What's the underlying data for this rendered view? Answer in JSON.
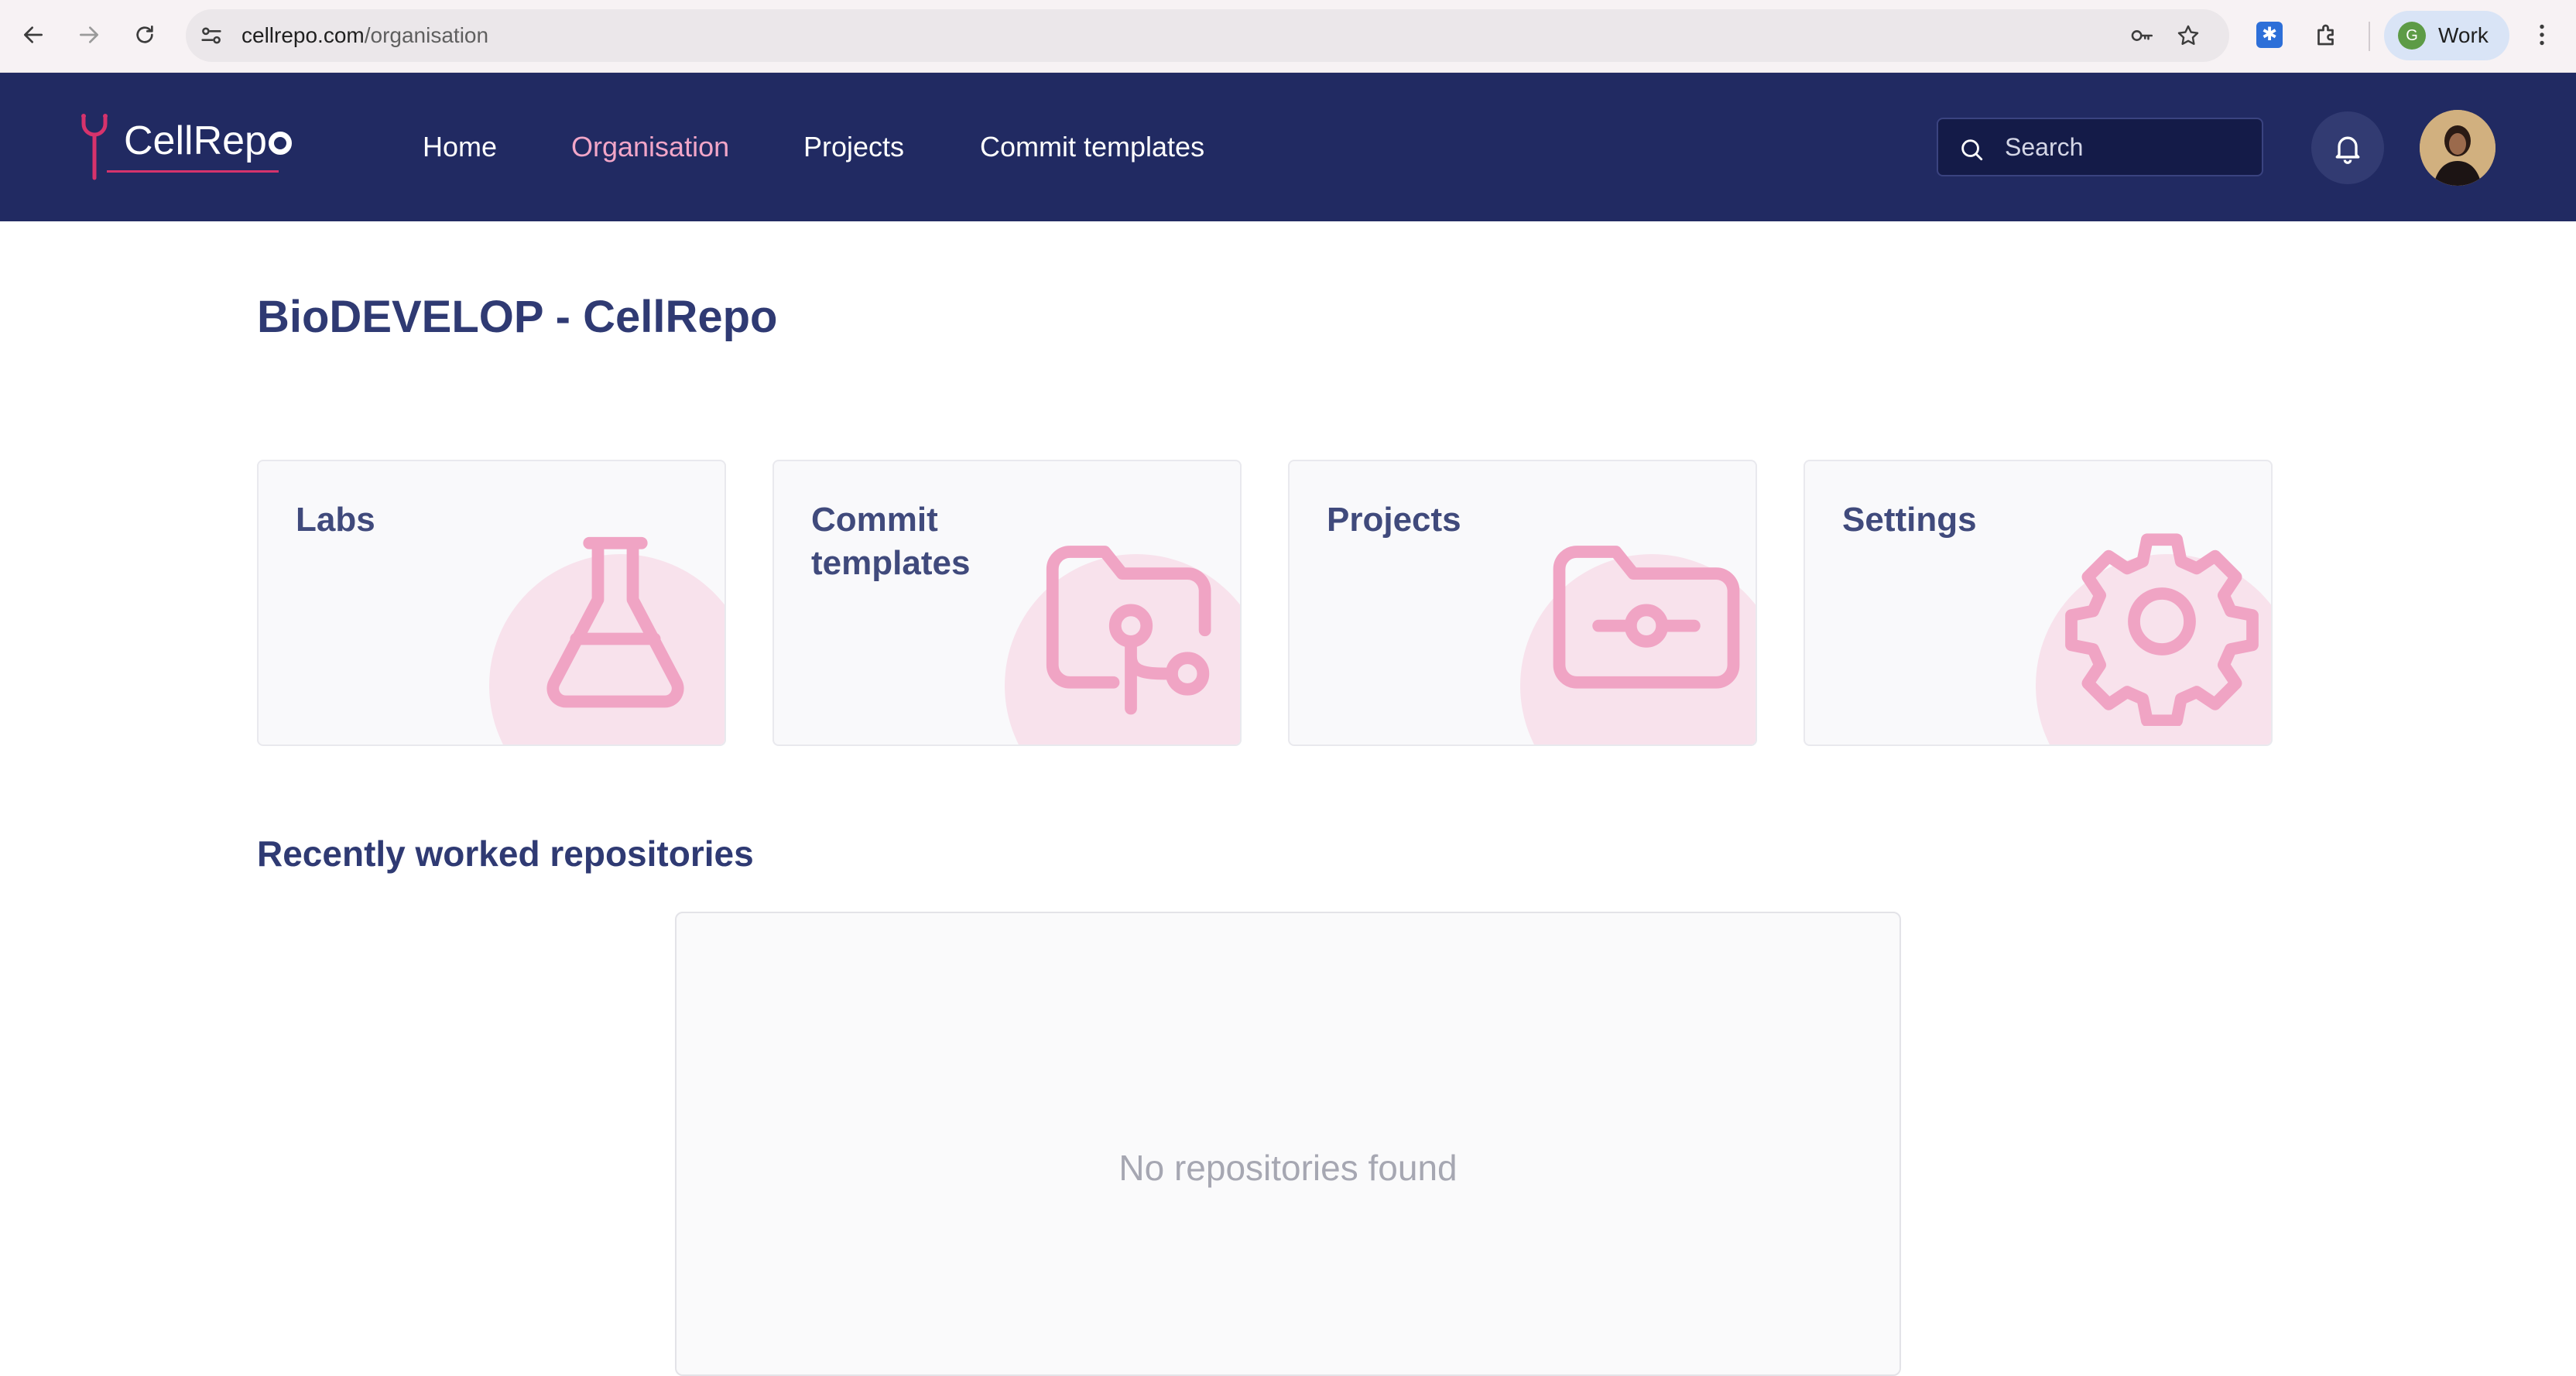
{
  "browser": {
    "url_host": "cellrepo.com",
    "url_path": "/organisation",
    "profile_initial": "G",
    "profile_label": "Work"
  },
  "app": {
    "logo_text": "CellRep",
    "nav": [
      {
        "label": "Home",
        "active": false
      },
      {
        "label": "Organisation",
        "active": true
      },
      {
        "label": "Projects",
        "active": false
      },
      {
        "label": "Commit templates",
        "active": false
      }
    ],
    "search_placeholder": "Search"
  },
  "main": {
    "title": "BioDEVELOP - CellRepo",
    "cards": [
      {
        "label": "Labs",
        "icon": "flask-icon"
      },
      {
        "label": "Commit templates",
        "icon": "folder-git-icon"
      },
      {
        "label": "Projects",
        "icon": "folder-commit-icon"
      },
      {
        "label": "Settings",
        "icon": "gear-icon"
      }
    ],
    "recent_title": "Recently worked repositories",
    "empty_message": "No repositories found"
  },
  "colors": {
    "header_bg": "#212a62",
    "active_nav": "#f2a6c8",
    "accent_pink": "#f0a4c4",
    "title_color": "#2f3a73"
  }
}
